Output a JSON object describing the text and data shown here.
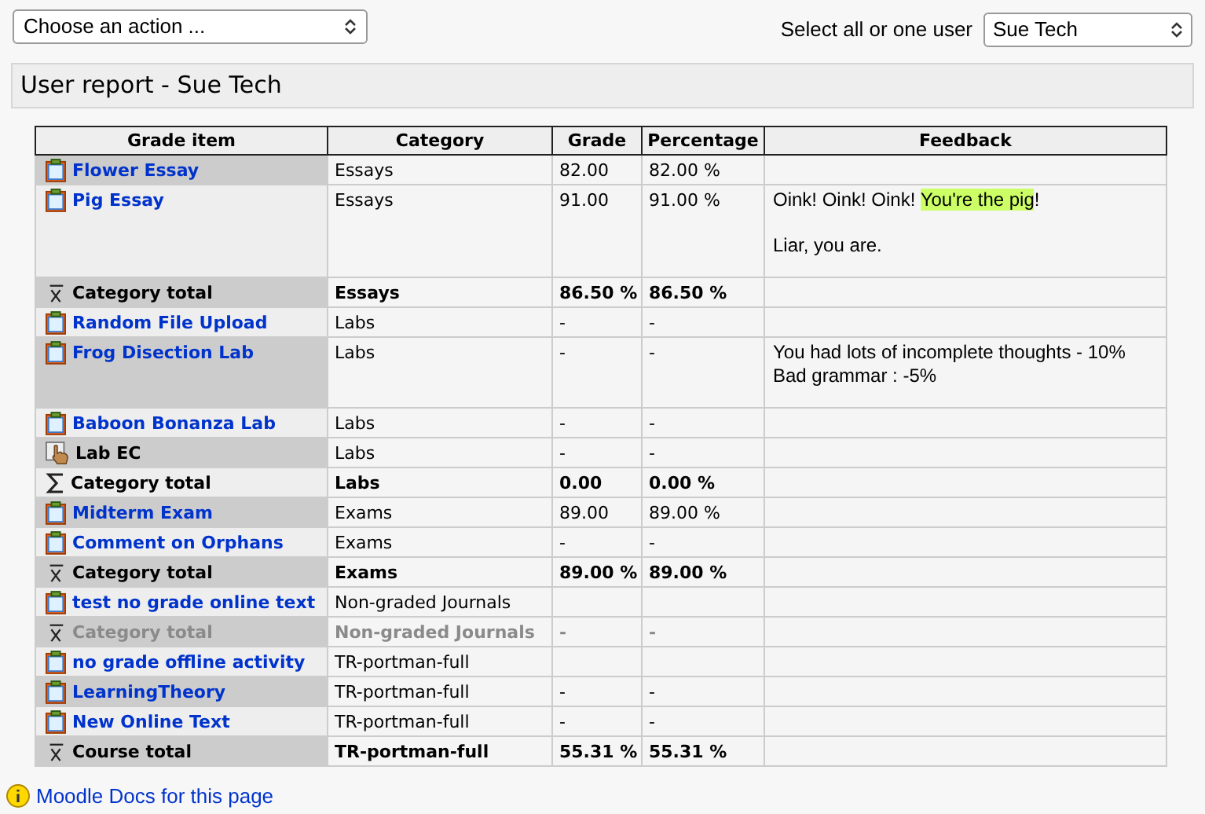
{
  "action_select": {
    "value": "Choose an action ..."
  },
  "user_select": {
    "label": "Select all or one user",
    "value": "Sue Tech"
  },
  "heading": "User report - Sue Tech",
  "table": {
    "columns": [
      "Grade item",
      "Category",
      "Grade",
      "Percentage",
      "Feedback"
    ],
    "rows": [
      {
        "kind": "item",
        "name": "Flower Essay",
        "category": "Essays",
        "grade": "82.00",
        "percentage": "82.00 %",
        "disabled": false
      },
      {
        "kind": "item",
        "name": "Pig Essay",
        "category": "Essays",
        "grade": "91.00",
        "percentage": "91.00 %",
        "disabled": false,
        "feedback": [
          [
            {
              "text": "Oink! Oink! Oink! ",
              "highlight": false
            },
            {
              "text": "You're the pig",
              "highlight": true
            },
            {
              "text": "!",
              "highlight": false
            }
          ],
          [
            {
              "text": "Liar, you are.",
              "highlight": false
            }
          ]
        ]
      },
      {
        "kind": "mean_total",
        "name": "Category total",
        "category": "Essays",
        "grade": "86.50 %",
        "percentage": "86.50 %",
        "disabled": false
      },
      {
        "kind": "item",
        "name": "Random File Upload",
        "category": "Labs",
        "grade": "-",
        "percentage": "-",
        "disabled": false
      },
      {
        "kind": "item",
        "name": "Frog Disection Lab",
        "category": "Labs",
        "grade": "-",
        "percentage": "-",
        "disabled": false,
        "feedback": [
          [
            {
              "text": "You had lots of incomplete thoughts - 10%\nBad grammar : -5%",
              "highlight": false
            }
          ]
        ]
      },
      {
        "kind": "item",
        "name": "Baboon Bonanza Lab",
        "category": "Labs",
        "grade": "-",
        "percentage": "-",
        "disabled": false
      },
      {
        "kind": "manual",
        "name": "Lab EC",
        "category": "Labs",
        "grade": "-",
        "percentage": "-",
        "disabled": false
      },
      {
        "kind": "sum_total",
        "name": "Category total",
        "category": "Labs",
        "grade": "0.00",
        "percentage": "0.00 %",
        "disabled": false
      },
      {
        "kind": "item",
        "name": "Midterm Exam",
        "category": "Exams",
        "grade": "89.00",
        "percentage": "89.00 %",
        "disabled": false
      },
      {
        "kind": "item",
        "name": "Comment on Orphans",
        "category": "Exams",
        "grade": "-",
        "percentage": "-",
        "disabled": false
      },
      {
        "kind": "mean_total",
        "name": "Category total",
        "category": "Exams",
        "grade": "89.00 %",
        "percentage": "89.00 %",
        "disabled": false
      },
      {
        "kind": "item",
        "name": "test no grade online text",
        "category": "Non-graded Journals",
        "disabled": false
      },
      {
        "kind": "mean_total",
        "name": "Category total",
        "category": "Non-graded Journals",
        "grade": "-",
        "percentage": "-",
        "disabled": true
      },
      {
        "kind": "item",
        "name": "no grade offline activity",
        "category": "TR-portman-full",
        "disabled": false
      },
      {
        "kind": "item",
        "name": "LearningTheory",
        "category": "TR-portman-full",
        "grade": "-",
        "percentage": "-",
        "disabled": false
      },
      {
        "kind": "item",
        "name": "New Online Text",
        "category": "TR-portman-full",
        "grade": "-",
        "percentage": "-",
        "disabled": false
      },
      {
        "kind": "mean_total",
        "name": "Course total",
        "category": "TR-portman-full",
        "grade": "55.31 %",
        "percentage": "55.31 %",
        "disabled": false
      }
    ]
  },
  "docs_link": "Moodle Docs for this page"
}
